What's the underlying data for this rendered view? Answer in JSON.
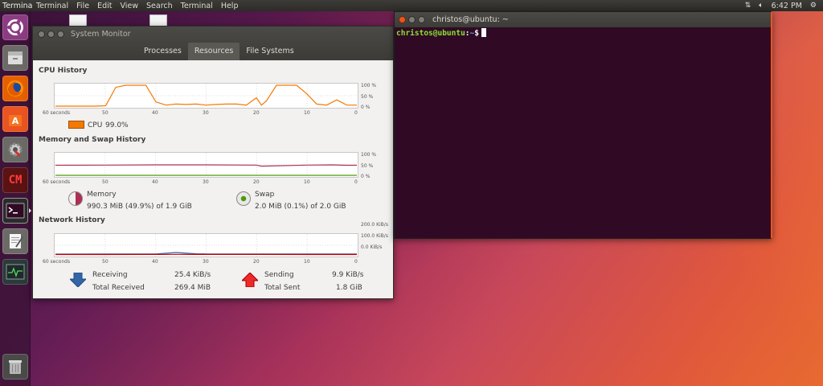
{
  "top_panel": {
    "app_name": "Terminal",
    "menu": [
      "Terminal",
      "File",
      "Edit",
      "View",
      "Search",
      "Terminal",
      "Help"
    ],
    "time": "6:42 PM"
  },
  "launcher": {
    "items": [
      "ubuntu-dash-icon",
      "files-icon",
      "firefox-icon",
      "software-center-icon",
      "system-settings-icon",
      "cm-app-icon",
      "terminal-icon",
      "text-editor-icon",
      "system-monitor-icon",
      "trash-icon"
    ],
    "cm_label": "CM"
  },
  "sysmon": {
    "title": "System Monitor",
    "tabs": [
      "Processes",
      "Resources",
      "File Systems"
    ],
    "active_tab": "Resources",
    "cpu": {
      "title": "CPU History",
      "legend_label": "CPU",
      "legend_value": "99.0%",
      "color": "#f57900"
    },
    "memory": {
      "title": "Memory and Swap History",
      "mem_label": "Memory",
      "mem_value": "990.3 MiB (49.9%) of 1.9 GiB",
      "mem_color": "#ad3054",
      "swap_label": "Swap",
      "swap_value": "2.0 MiB (0.1%) of 2.0 GiB",
      "swap_color": "#4e9a06"
    },
    "network": {
      "title": "Network History",
      "receiving_label": "Receiving",
      "receiving_value": "25.4 KiB/s",
      "total_received_label": "Total Received",
      "total_received_value": "269.4 MiB",
      "sending_label": "Sending",
      "sending_value": "9.9 KiB/s",
      "total_sent_label": "Total Sent",
      "total_sent_value": "1.8 GiB"
    },
    "x_ticks": [
      "60 seconds",
      "50",
      "40",
      "30",
      "20",
      "10",
      "0"
    ],
    "pct_ticks": [
      "100 %",
      "50 %",
      "0 %"
    ],
    "net_ticks": [
      "200.0 KiB/s",
      "100.0 KiB/s",
      "0.0 KiB/s"
    ]
  },
  "chart_data": [
    {
      "type": "line",
      "title": "CPU History",
      "x": [
        60,
        58,
        56,
        54,
        52,
        50,
        48,
        46,
        44,
        42,
        40,
        38,
        36,
        34,
        32,
        30,
        28,
        26,
        24,
        22,
        20,
        19,
        18,
        16,
        14,
        12,
        10,
        8,
        6,
        4,
        2,
        0
      ],
      "series": [
        {
          "name": "CPU",
          "values": [
            0,
            0,
            0,
            0,
            0,
            2,
            90,
            100,
            100,
            100,
            20,
            5,
            10,
            8,
            10,
            5,
            8,
            10,
            10,
            5,
            40,
            5,
            25,
            100,
            100,
            100,
            60,
            10,
            5,
            30,
            5,
            5
          ]
        }
      ],
      "ylim": [
        0,
        100
      ]
    },
    {
      "type": "line",
      "title": "Memory and Swap History",
      "x": [
        60,
        50,
        40,
        30,
        20,
        19,
        10,
        5,
        2,
        0
      ],
      "series": [
        {
          "name": "Memory",
          "values": [
            48,
            49,
            50,
            50,
            49,
            44,
            49,
            50,
            48,
            48
          ]
        },
        {
          "name": "Swap",
          "values": [
            0.1,
            0.1,
            0.1,
            0.1,
            0.1,
            0.1,
            0.1,
            0.1,
            0.1,
            0.1
          ]
        }
      ],
      "ylim": [
        0,
        100
      ]
    },
    {
      "type": "line",
      "title": "Network History",
      "x": [
        60,
        50,
        40,
        36,
        32,
        30,
        20,
        10,
        0
      ],
      "series": [
        {
          "name": "Receiving",
          "values": [
            8,
            9,
            10,
            25,
            12,
            10,
            10,
            9,
            9
          ]
        },
        {
          "name": "Sending",
          "values": [
            4,
            4,
            5,
            6,
            5,
            5,
            5,
            4,
            4
          ]
        }
      ],
      "ylim": [
        0,
        200
      ],
      "units": "KiB/s"
    }
  ],
  "terminal": {
    "title": "christos@ubuntu: ~",
    "prompt_user": "christos@ubuntu",
    "prompt_path": "~",
    "prompt_symbol": "$"
  }
}
